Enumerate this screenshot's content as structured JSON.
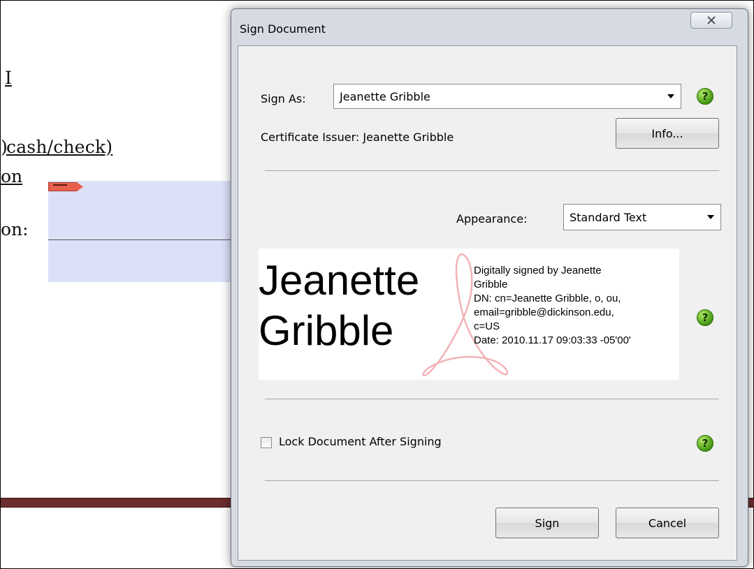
{
  "document": {
    "fragments": [
      "I",
      "cash/check)",
      "on",
      "on:"
    ]
  },
  "dialog": {
    "title": "Sign Document",
    "close_glyph": "X",
    "sign_as_label": "Sign As:",
    "sign_as_value": "Jeanette Gribble",
    "certificate_issuer": "Certificate Issuer: Jeanette Gribble",
    "info_button": "Info...",
    "appearance_label": "Appearance:",
    "appearance_value": "Standard Text",
    "preview": {
      "name_line1": "Jeanette",
      "name_line2": "Gribble",
      "details": [
        "Digitally signed by Jeanette",
        "Gribble",
        "DN: cn=Jeanette Gribble, o, ou,",
        "email=gribble@dickinson.edu,",
        "c=US",
        "Date: 2010.11.17 09:03:33 -05'00'"
      ]
    },
    "lock_checkbox_label": "Lock Document After Signing",
    "lock_checked": false,
    "sign_button": "Sign",
    "cancel_button": "Cancel",
    "help_glyph": "?"
  },
  "colors": {
    "help_icon": "#4a9d16",
    "field_highlight": "#dde1f8",
    "doc_bar": "#6b2d2d"
  },
  "icons": {
    "help": "question-mark-icon",
    "dropdown": "chevron-down-icon",
    "close": "close-icon",
    "watermark": "acrobat-logo-icon"
  }
}
